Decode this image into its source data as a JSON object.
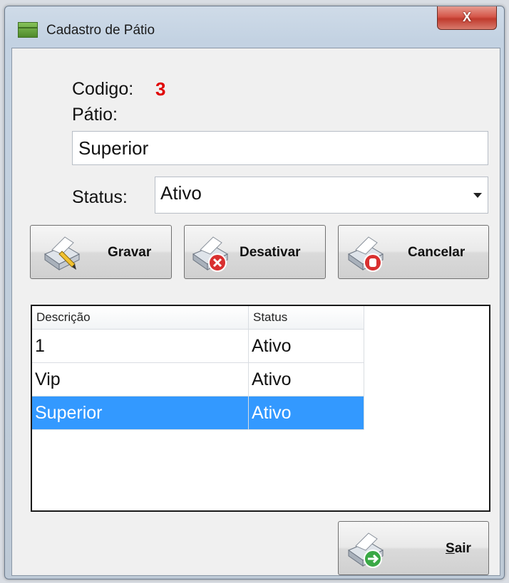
{
  "window": {
    "title": "Cadastro de Pátio",
    "close_label": "X"
  },
  "form": {
    "codigo_label": "Codigo:",
    "codigo_value": "3",
    "patio_label": "Pátio:",
    "patio_value": "Superior",
    "status_label": "Status:",
    "status_value": "Ativo"
  },
  "buttons": {
    "gravar": "Gravar",
    "desativar": "Desativar",
    "cancelar": "Cancelar",
    "sair_mnemonic": "S",
    "sair_rest": "air"
  },
  "grid": {
    "columns": [
      "Descrição",
      "Status"
    ],
    "rows": [
      {
        "descricao": "1",
        "status": "Ativo",
        "selected": false
      },
      {
        "descricao": "Vip",
        "status": "Ativo",
        "selected": false
      },
      {
        "descricao": "Superior",
        "status": "Ativo",
        "selected": true
      }
    ]
  },
  "icons": {
    "app": "green-form-icon",
    "gravar": "printer-pencil-icon",
    "desativar": "printer-delete-icon",
    "cancelar": "printer-stop-icon",
    "sair": "printer-exit-icon"
  },
  "colors": {
    "codigo_value": "#e00000",
    "selection": "#3399ff",
    "close_button": "#c03b2e"
  }
}
